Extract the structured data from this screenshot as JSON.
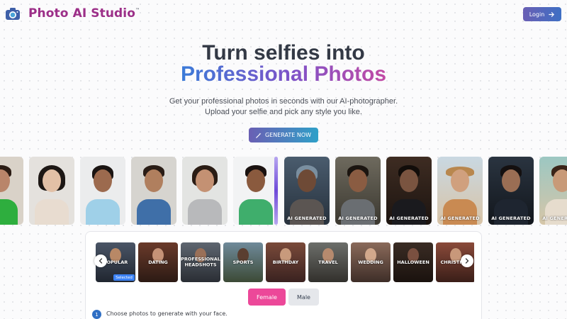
{
  "header": {
    "brand": "Photo AI Studio",
    "brand_tm": "™",
    "login_label": "Login"
  },
  "hero": {
    "line1": "Turn selfies into",
    "line2": "Professional Photos",
    "subtitle_line1": "Get your professional photos in seconds with our AI-photographer.",
    "subtitle_line2": "Upload your selfie and pick any style you like.",
    "cta_label": "GENERATE NOW"
  },
  "gallery": {
    "ai_label": "AI GENERATED"
  },
  "styles": {
    "items": [
      {
        "label": "POPULAR"
      },
      {
        "label": "DATING"
      },
      {
        "label": "PROFESSIONAL HEADSHOTS"
      },
      {
        "label": "SPORTS"
      },
      {
        "label": "BIRTHDAY"
      },
      {
        "label": "TRAVEL"
      },
      {
        "label": "WEDDING"
      },
      {
        "label": "HALLOWEEN"
      },
      {
        "label": "CHRISTMAS"
      }
    ],
    "selected_badge": "Selected"
  },
  "gender": {
    "female_label": "Female",
    "male_label": "Male",
    "selected": "Female"
  },
  "steps": [
    {
      "number": "1",
      "text": "Choose photos to generate with your face."
    }
  ],
  "colors": {
    "brand": "#9c2f88",
    "accent": "#ec4899",
    "primary": "#3e6fc4"
  }
}
